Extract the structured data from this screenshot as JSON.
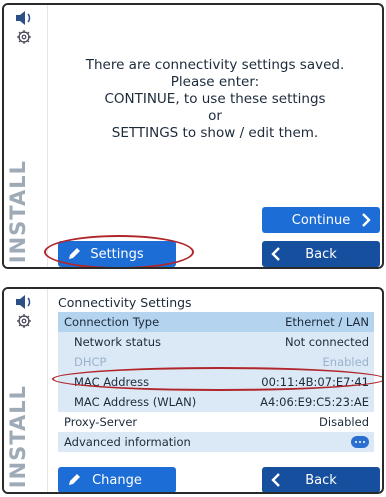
{
  "sidebar": {
    "install_label": "INSTALL"
  },
  "screen1": {
    "message_lines": [
      "There are connectivity settings saved.",
      "Please enter:",
      "CONTINUE, to use these settings",
      "or",
      "SETTINGS to show / edit them."
    ],
    "continue_label": "Continue",
    "settings_label": "Settings",
    "back_label": "Back"
  },
  "screen2": {
    "title": "Connectivity Settings",
    "rows": [
      {
        "label": "Connection Type",
        "value": "Ethernet / LAN"
      },
      {
        "label": "Network status",
        "value": "Not connected"
      },
      {
        "label": "DHCP",
        "value": "Enabled"
      },
      {
        "label": "MAC Address",
        "value": "00:11:4B:07:E7:41"
      },
      {
        "label": "MAC Address (WLAN)",
        "value": "A4:06:E9:C5:23:AE"
      },
      {
        "label": "Proxy-Server",
        "value": "Disabled"
      },
      {
        "label": "Advanced information",
        "value": ""
      }
    ],
    "change_label": "Change",
    "back_label": "Back"
  },
  "colors": {
    "button_blue": "#1d6dd6",
    "highlight_red": "#b0262b",
    "row_header": "#b4d3ef",
    "row_light": "#dbe9f7",
    "install_text": "#9eaab6"
  },
  "icons": [
    "speaker-icon",
    "gear-icon",
    "chevron-right-icon",
    "chevron-left-icon",
    "pencil-icon",
    "more-icon"
  ]
}
